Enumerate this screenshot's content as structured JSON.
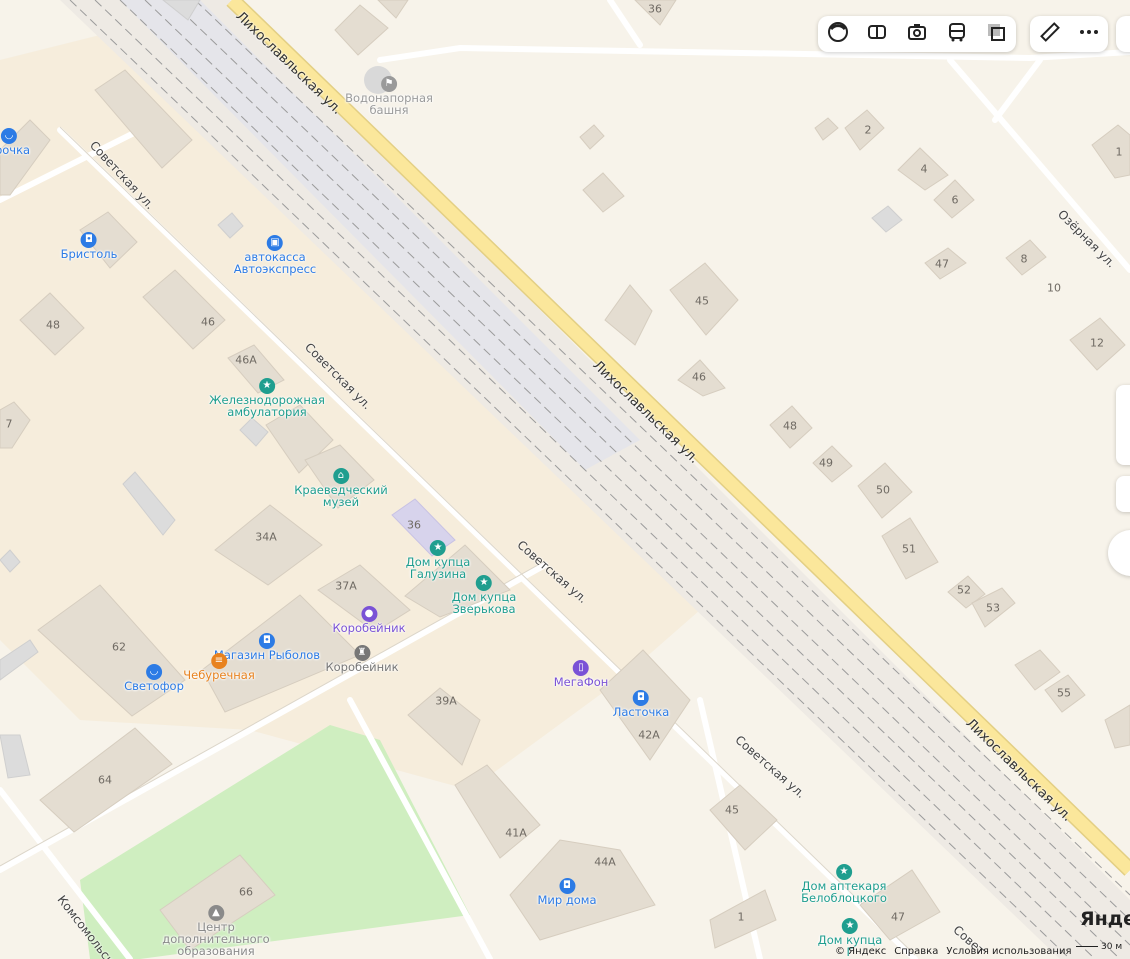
{
  "streets": [
    {
      "text": "Лихославльская ул."
    },
    {
      "text": "Лихославльская ул."
    },
    {
      "text": "Лихославльская ул."
    },
    {
      "text": "Советская ул."
    },
    {
      "text": "Советская ул."
    },
    {
      "text": "Советская ул."
    },
    {
      "text": "Советская ул."
    },
    {
      "text": "Озёрная ул."
    },
    {
      "text": "Комсомольская ул."
    },
    {
      "text": "Совет"
    }
  ],
  "pois": [
    {
      "label": "Водонапорная\nбашня",
      "icon": "flag-icon",
      "color": "#9a9a9a"
    },
    {
      "label": "автокасса\nАвтоэкспресс",
      "icon": "bus-icon",
      "color": "#2c7be5"
    },
    {
      "label": "Бристоль",
      "icon": "shopping-bag-icon",
      "color": "#2c7be5"
    },
    {
      "label": "ёрочка",
      "icon": "basket-icon",
      "color": "#2c7be5"
    },
    {
      "label": "Железнодорожная\nамбулатория",
      "icon": "star-icon",
      "color": "#1f9e8f"
    },
    {
      "label": "Краеведческий\nмузей",
      "icon": "museum-icon",
      "color": "#1f9e8f"
    },
    {
      "label": "Дом купца\nГалузина",
      "icon": "star-icon",
      "color": "#1f9e8f"
    },
    {
      "label": "Дом купца\nЗверькова",
      "icon": "star-icon",
      "color": "#1f9e8f"
    },
    {
      "label": "Коробейник",
      "icon": "circle-icon",
      "color": "#7a52d6"
    },
    {
      "label": "Магазин Рыболов",
      "icon": "shopping-bag-icon",
      "color": "#2c7be5"
    },
    {
      "label": "Чебуречная",
      "icon": "food-icon",
      "color": "#e8821e"
    },
    {
      "label": "Светофор",
      "icon": "basket-icon",
      "color": "#2c7be5"
    },
    {
      "label": "Коробейник",
      "icon": "monument-icon",
      "color": "#777777"
    },
    {
      "label": "МегаФон",
      "icon": "phone-icon",
      "color": "#7a52d6"
    },
    {
      "label": "Ласточка",
      "icon": "shopping-bag-icon",
      "color": "#2c7be5"
    },
    {
      "label": "Мир дома",
      "icon": "shopping-bag-icon",
      "color": "#2c7be5"
    },
    {
      "label": "Центр\nдополнительного\nобразования",
      "icon": "education-icon",
      "color": "#8a8a8a"
    },
    {
      "label": "Дом аптекаря\nБелоблоцкого",
      "icon": "star-icon",
      "color": "#1f9e8f"
    },
    {
      "label": "Дом купца\nГ",
      "icon": "star-icon",
      "color": "#1f9e8f"
    }
  ],
  "house_numbers": [
    "36",
    "2",
    "1",
    "4",
    "6",
    "8",
    "10",
    "47",
    "45",
    "12",
    "46",
    "48",
    "49",
    "50",
    "51",
    "52",
    "53",
    "55",
    "48",
    "46",
    "46А",
    "7",
    "36",
    "34А",
    "37А",
    "62",
    "39А",
    "42А",
    "64",
    "41А",
    "45",
    "44А",
    "66",
    "1",
    "47"
  ],
  "toolbar": {
    "layers": [
      {
        "icon": "layers-icon"
      },
      {
        "icon": "panorama-icon"
      },
      {
        "icon": "camera-icon"
      },
      {
        "icon": "bus-icon"
      },
      {
        "icon": "overlay-icon"
      }
    ],
    "tools": [
      {
        "icon": "ruler-icon"
      },
      {
        "icon": "more-icon"
      }
    ]
  },
  "footer": {
    "copyright": "© Яндекс",
    "help": "Справка",
    "terms": "Условия использования",
    "scale": "30 м",
    "brand": "Яндекс"
  },
  "colors": {
    "background": "#f7f3ea",
    "major_road": "#fbe79b",
    "park": "#cfeec0",
    "building": "#e4ddd1",
    "railway": "#9b9b9b"
  }
}
